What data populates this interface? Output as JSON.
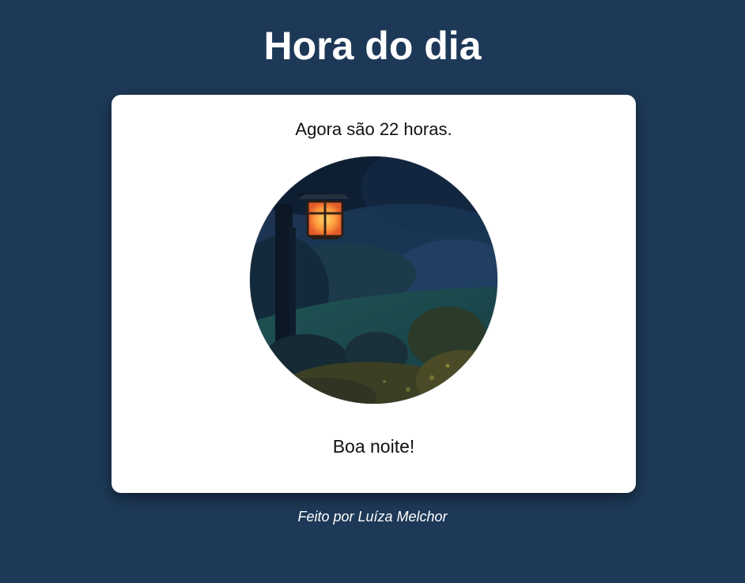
{
  "page": {
    "title": "Hora do dia",
    "background_color": "#1d3957"
  },
  "card": {
    "time_message": "Agora são 22 horas.",
    "image_icon": "night-garden-lantern-photo",
    "greeting": "Boa noite!"
  },
  "footer": {
    "credit": "Feito por Luíza Melchor"
  }
}
